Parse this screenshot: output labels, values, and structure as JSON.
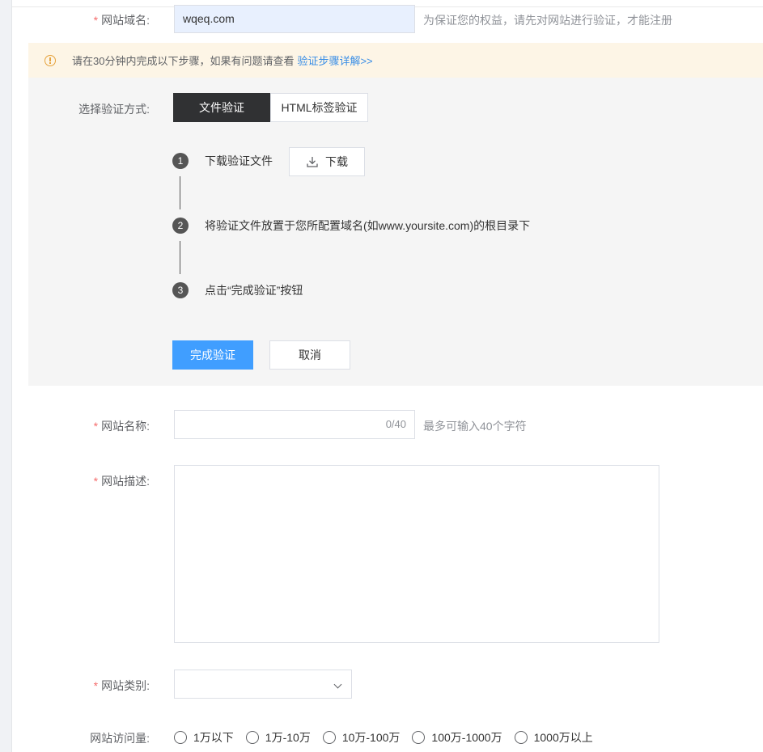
{
  "domain_row": {
    "label": "网站域名:",
    "required_mark": "*",
    "value": "wqeq.com",
    "hint": "为保证您的权益，请先对网站进行验证，才能注册"
  },
  "notice": {
    "text": "请在30分钟内完成以下步骤，如果有问题请查看",
    "link": "验证步骤详解>>",
    "accent_color": "#e6a23c"
  },
  "verify": {
    "label": "选择验证方式:",
    "tabs": [
      {
        "label": "文件验证",
        "active": true
      },
      {
        "label": "HTML标签验证",
        "active": false
      }
    ],
    "steps": [
      {
        "num": "1",
        "text": "下载验证文件"
      },
      {
        "num": "2",
        "text": "将验证文件放置于您所配置域名(如www.yoursite.com)的根目录下"
      },
      {
        "num": "3",
        "text": "点击“完成验证”按钮"
      }
    ],
    "download_label": "下载",
    "download_icon": "download-icon",
    "complete_label": "完成验证",
    "cancel_label": "取消",
    "primary_color": "#409eff"
  },
  "name_row": {
    "label": "网站名称:",
    "required_mark": "*",
    "counter": "0/40",
    "hint": "最多可输入40个字符"
  },
  "desc_row": {
    "label": "网站描述:",
    "required_mark": "*"
  },
  "category_row": {
    "label": "网站类别:",
    "required_mark": "*",
    "icon": "chevron-down-icon"
  },
  "traffic_row": {
    "label": "网站访问量:",
    "options": [
      "1万以下",
      "1万-10万",
      "10万-100万",
      "100万-1000万",
      "1000万以上"
    ]
  }
}
